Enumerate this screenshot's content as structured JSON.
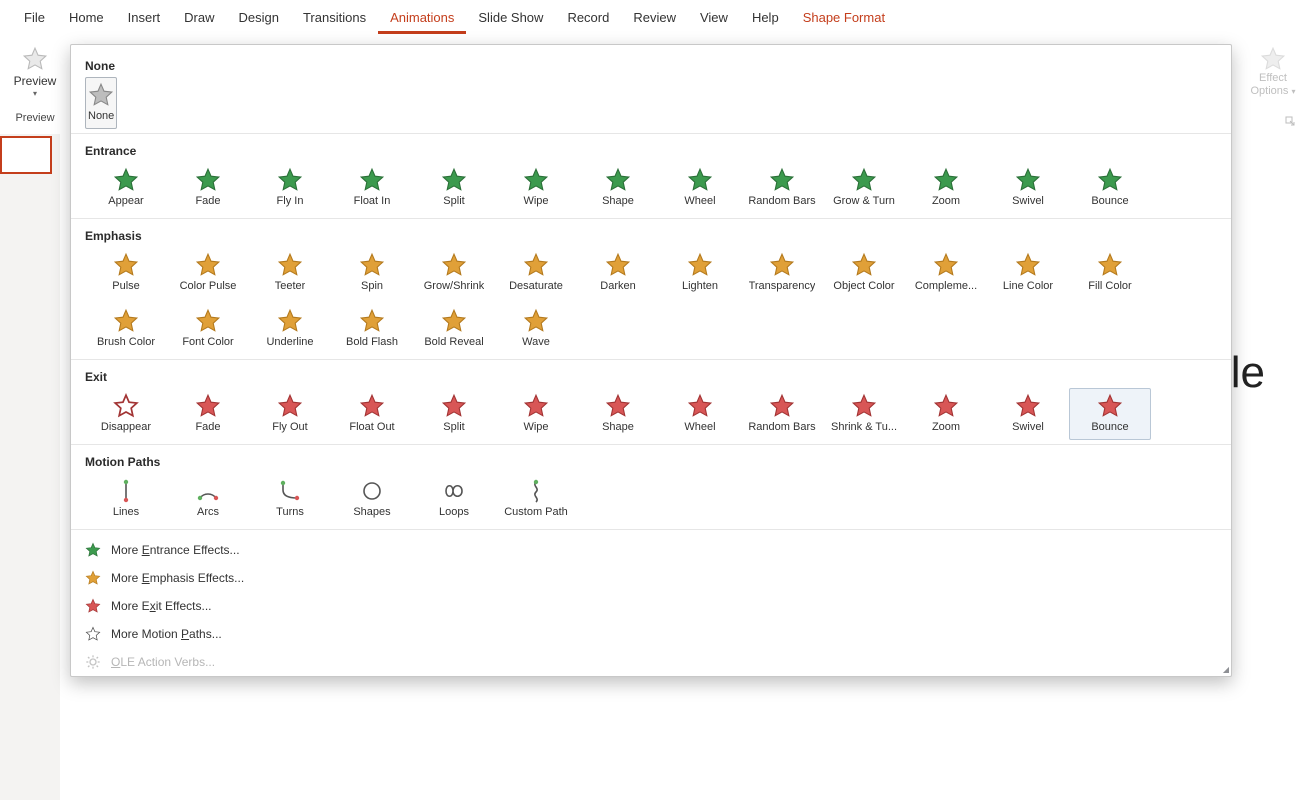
{
  "tabs": [
    "File",
    "Home",
    "Insert",
    "Draw",
    "Design",
    "Transitions",
    "Animations",
    "Slide Show",
    "Record",
    "Review",
    "View",
    "Help",
    "Shape Format"
  ],
  "active_tab": "Animations",
  "contextual_tab": "Shape Format",
  "preview": {
    "label": "Preview",
    "section": "Preview"
  },
  "effect_options": {
    "line1": "Effect",
    "line2": "Options"
  },
  "sections": {
    "none": {
      "title": "None",
      "items": [
        "None"
      ]
    },
    "entrance": {
      "title": "Entrance",
      "items": [
        "Appear",
        "Fade",
        "Fly In",
        "Float In",
        "Split",
        "Wipe",
        "Shape",
        "Wheel",
        "Random Bars",
        "Grow & Turn",
        "Zoom",
        "Swivel",
        "Bounce"
      ]
    },
    "emphasis": {
      "title": "Emphasis",
      "items": [
        "Pulse",
        "Color Pulse",
        "Teeter",
        "Spin",
        "Grow/Shrink",
        "Desaturate",
        "Darken",
        "Lighten",
        "Transparency",
        "Object Color",
        "Compleme...",
        "Line Color",
        "Fill Color",
        "Brush Color",
        "Font Color",
        "Underline",
        "Bold Flash",
        "Bold Reveal",
        "Wave"
      ]
    },
    "exit": {
      "title": "Exit",
      "items": [
        "Disappear",
        "Fade",
        "Fly Out",
        "Float Out",
        "Split",
        "Wipe",
        "Shape",
        "Wheel",
        "Random Bars",
        "Shrink & Tu...",
        "Zoom",
        "Swivel",
        "Bounce"
      ]
    },
    "motion": {
      "title": "Motion Paths",
      "items": [
        "Lines",
        "Arcs",
        "Turns",
        "Shapes",
        "Loops",
        "Custom Path"
      ]
    }
  },
  "hovered_item_section": "exit",
  "hovered_item_index": 12,
  "selected_item_section": "none",
  "selected_item_index": 0,
  "bottom_menu": {
    "entrance": "More Entrance Effects...",
    "emphasis": "More Emphasis Effects...",
    "exit": "More Exit Effects...",
    "motion": "More Motion Paths...",
    "ole": "OLE Action Verbs..."
  },
  "slide_text_fragment": "le",
  "colors": {
    "entrance": "#3c9a4e",
    "emphasis": "#e0a038",
    "exit": "#d85656",
    "motion_stroke": "#555",
    "none_fill": "#bdbdbd",
    "none_stroke": "#888"
  }
}
